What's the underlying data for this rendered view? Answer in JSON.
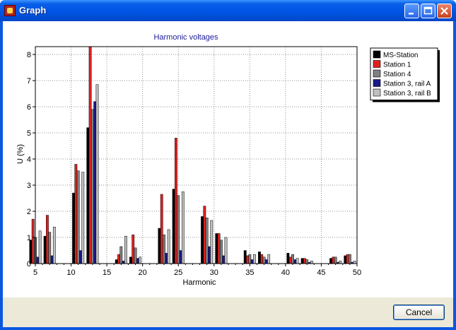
{
  "window": {
    "title": "Graph",
    "buttons": {
      "cancel_label": "Cancel"
    }
  },
  "colors": {
    "titlebar": "#0055e5",
    "client_bg": "#ece9d8",
    "plot_title": "#1a1a9a"
  },
  "chart_data": {
    "type": "bar",
    "title": "Harmonic voltages",
    "xlabel": "Harmonic",
    "ylabel": "U (%)",
    "xlim": [
      5,
      50
    ],
    "ylim": [
      0,
      8.3
    ],
    "xticks": [
      5,
      10,
      15,
      20,
      25,
      30,
      35,
      40,
      45,
      50
    ],
    "yticks": [
      0,
      1,
      2,
      3,
      4,
      5,
      6,
      7,
      8
    ],
    "grid": true,
    "legend_position": "top-right",
    "x": [
      5,
      7,
      11,
      13,
      17,
      19,
      23,
      25,
      29,
      31,
      35,
      37,
      41,
      43,
      47,
      49
    ],
    "series": [
      {
        "name": "MS-Station",
        "color": "#000000",
        "values": [
          0.9,
          1.05,
          2.7,
          5.2,
          0.15,
          0.25,
          1.35,
          2.85,
          1.8,
          1.15,
          0.5,
          0.45,
          0.4,
          0.2,
          0.2,
          0.3
        ]
      },
      {
        "name": "Station 1",
        "color": "#e02020",
        "values": [
          1.7,
          1.85,
          3.8,
          8.3,
          0.35,
          1.1,
          2.65,
          4.8,
          2.2,
          1.15,
          0.3,
          0.35,
          0.25,
          0.2,
          0.25,
          0.35
        ]
      },
      {
        "name": "Station 4",
        "color": "#808080",
        "values": [
          1.0,
          1.2,
          3.55,
          5.9,
          0.65,
          0.6,
          1.1,
          2.6,
          1.75,
          0.9,
          0.35,
          0.25,
          0.35,
          0.15,
          0.25,
          0.35
        ]
      },
      {
        "name": "Station 3, rail A",
        "color": "#1a1a8a",
        "values": [
          0.25,
          0.3,
          0.5,
          6.2,
          0.1,
          0.2,
          0.4,
          0.5,
          0.65,
          0.3,
          0.15,
          0.15,
          0.15,
          0.05,
          0.05,
          0.05
        ]
      },
      {
        "name": "Station 3, rail B",
        "color": "#c0c0c0",
        "values": [
          1.25,
          1.4,
          3.5,
          6.85,
          1.05,
          0.25,
          1.3,
          2.75,
          1.65,
          1.0,
          0.35,
          0.35,
          0.2,
          0.1,
          0.1,
          0.1
        ]
      }
    ]
  }
}
